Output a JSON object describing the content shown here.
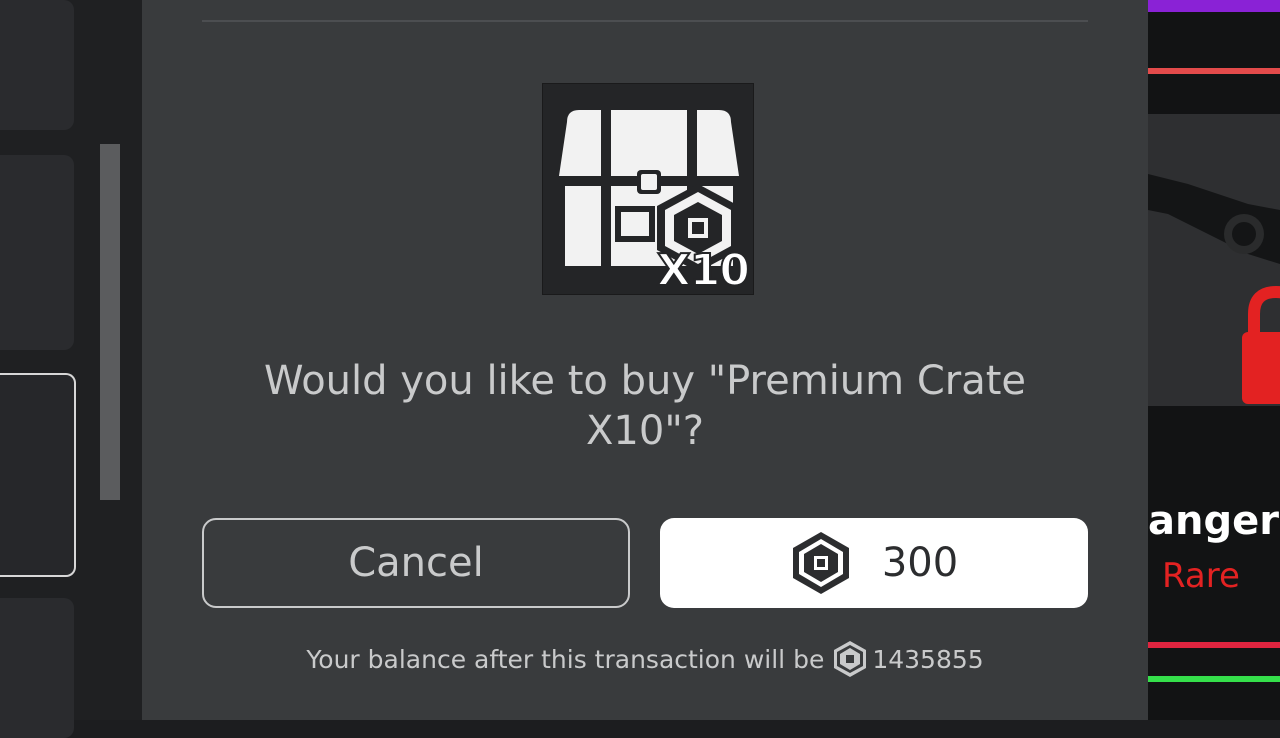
{
  "dialog": {
    "prompt": "Would you like to buy \"Premium Crate X10\"?",
    "product_multiplier": "X10",
    "cancel_label": "Cancel",
    "price": "300",
    "balance_text": "Your balance after this transaction will be",
    "balance_after": "1435855"
  },
  "background_item": {
    "name_fragment": "anger",
    "rarity": "Rare"
  },
  "colors": {
    "modal_bg": "#393b3d",
    "buy_button_bg": "#ffffff",
    "rarity_red": "#e32222",
    "accent_purple": "#8a22d6"
  },
  "icons": {
    "product": "treasure-chest-robux-icon",
    "currency": "robux-icon",
    "lock": "lock-icon"
  }
}
